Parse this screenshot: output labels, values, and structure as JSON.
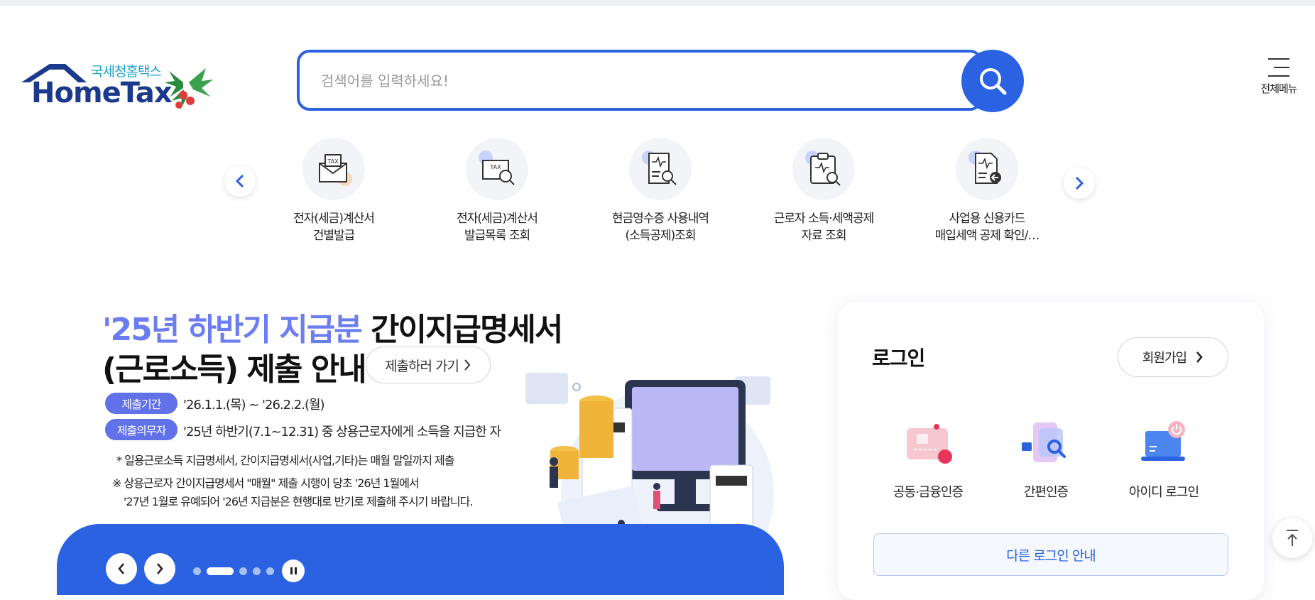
{
  "logo": {
    "subtitle": "국세청홈택스",
    "name": "HomeTax"
  },
  "search": {
    "placeholder": "검색어를 입력하세요!"
  },
  "header": {
    "all_menu_label": "전체메뉴"
  },
  "quick_menu": {
    "items": [
      {
        "label": "전자(세금)계산서\n건별발급",
        "icon": "tax-envelope-icon"
      },
      {
        "label": "전자(세금)계산서\n발급목록 조회",
        "icon": "tax-search-icon"
      },
      {
        "label": "현금영수증 사용내역\n(소득공제)조회",
        "icon": "receipt-search-icon"
      },
      {
        "label": "근로자 소득·세액공제\n자료 조회",
        "icon": "clipboard-search-icon"
      },
      {
        "label": "사업용 신용카드\n매입세액 공제 확인/…",
        "icon": "document-arrow-icon"
      }
    ]
  },
  "banner": {
    "title_highlight": "'25년 하반기 지급분",
    "title_rest": " 간이지급명세서",
    "title_line2": "(근로소득) 제출 안내",
    "submit_label": "제출하러 가기",
    "period_tag": "제출기간",
    "period_text": "'26.1.1.(목) ~ '26.2.2.(월)",
    "obligor_tag": "제출의무자",
    "obligor_text": "'25년 하반기(7.1~12.31) 중 상용근로자에게 소득을 지급한 자",
    "note1": "* 일용근로소득 지급명세서, 간이지급명세서(사업,기타)는 매월 말일까지 제출",
    "note2": "※ 상용근로자 간이지급명세서 \"매월\" 제출 시행이 당초 '26년 1월에서",
    "note3": "'27년 1월로 유예되어 '26년 지급분은 현행대로 반기로 제출해 주시기 바랍니다."
  },
  "slider": {
    "total_dots": 5,
    "active_index": 0
  },
  "login": {
    "title": "로그인",
    "signup_label": "회원가입",
    "options": [
      {
        "label": "공동·금융인증",
        "icon": "certificate-card-icon"
      },
      {
        "label": "간편인증",
        "icon": "phone-search-icon"
      },
      {
        "label": "아이디 로그인",
        "icon": "laptop-power-icon"
      }
    ],
    "other_login_label": "다른 로그인 안내"
  },
  "colors": {
    "primary": "#2a62e2",
    "accent": "#6b7df0",
    "logo_navy": "#1b3a8c"
  }
}
